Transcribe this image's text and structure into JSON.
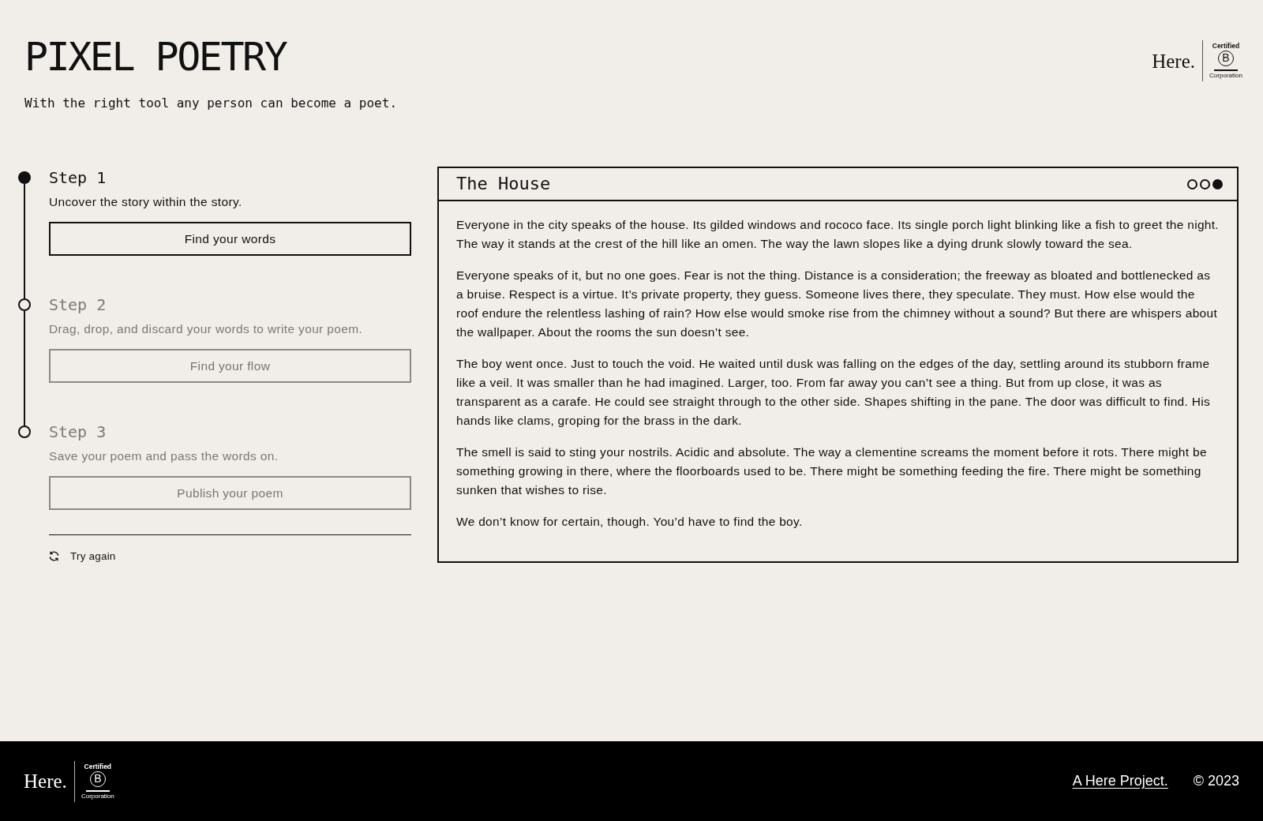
{
  "header": {
    "title": "PIXEL POETRY",
    "tagline": "With the right tool any person can become a poet.",
    "logo": {
      "wordmark": "Here.",
      "badge_top": "Certified",
      "badge_letter": "B",
      "badge_bottom": "Corporation"
    }
  },
  "steps": [
    {
      "title": "Step 1",
      "description": "Uncover the story within the story.",
      "button": "Find your words",
      "active": true
    },
    {
      "title": "Step 2",
      "description": "Drag, drop, and discard your words to write your poem.",
      "button": "Find your flow",
      "active": false
    },
    {
      "title": "Step 3",
      "description": "Save your poem and pass the words on.",
      "button": "Publish your poem",
      "active": false
    }
  ],
  "reset": {
    "label": "Try again"
  },
  "story": {
    "title": "The House",
    "pages": [
      {
        "selected": false
      },
      {
        "selected": false
      },
      {
        "selected": true
      }
    ],
    "paragraphs": [
      "Everyone in the city speaks of the house. Its gilded windows and rococo face. Its single porch light blinking like a fish to greet the night. The way it stands at the crest of the hill like an omen. The way the lawn slopes like a dying drunk slowly toward the sea.",
      "Everyone speaks of it, but no one goes. Fear is not the thing. Distance is a consideration; the freeway as bloated and bottlenecked as a bruise. Respect is a virtue. It’s private property, they guess. Someone lives there, they speculate. They must. How else would the roof endure the relentless lashing of rain? How else would smoke rise from the chimney without a sound? But there are whispers about the wallpaper. About the rooms the sun doesn’t see.",
      "The boy went once. Just to touch the void. He waited until dusk was falling on the edges of the day, settling around its stubborn frame like a veil. It was smaller than he had imagined. Larger, too. From far away you can’t see a thing. But from up close, it was as transparent as a carafe. He could see straight through to the other side. Shapes shifting in the pane. The door was difficult to find. His hands like clams, groping for the brass in the dark.",
      "The smell is said to sting your nostrils. Acidic and absolute. The way a clementine screams the moment before it rots. There might be something growing in there, where the floorboards used to be. There might be something feeding the fire. There might be something sunken that wishes to rise.",
      "We don’t know for certain, though. You’d have to find the boy."
    ]
  },
  "footer": {
    "logo": {
      "wordmark": "Here.",
      "badge_top": "Certified",
      "badge_letter": "B",
      "badge_bottom": "Corporation"
    },
    "link": "A Here Project.",
    "copyright": "© 2023"
  }
}
